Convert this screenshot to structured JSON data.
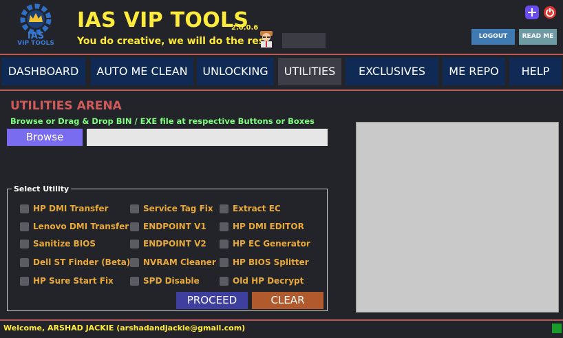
{
  "header": {
    "logo_line1": "IAS",
    "logo_line2": "VIP TOOLS",
    "title": "IAS VIP TOOLS",
    "version": "2.0.0.6",
    "tagline": "You do creative, we will do the rest",
    "logout_label": "LOGOUT",
    "readme_label": "READ ME"
  },
  "nav": {
    "tabs": [
      {
        "label": "DASHBOARD"
      },
      {
        "label": "AUTO ME CLEAN"
      },
      {
        "label": "UNLOCKING"
      },
      {
        "label": "UTILITIES"
      },
      {
        "label": "EXCLUSIVES"
      },
      {
        "label": "ME REPO"
      },
      {
        "label": "HELP"
      }
    ],
    "active": "UTILITIES"
  },
  "main": {
    "section_title": "UTILITIES ARENA",
    "instructions": "Browse or Drag & Drop BIN / EXE file at respective Buttons or Boxes",
    "browse_label": "Browse",
    "file_path_value": "",
    "group_label": "Select Utility",
    "utilities": {
      "col1": [
        "HP DMI Transfer",
        "Lenovo DMI Transfer",
        "Sanitize BIOS",
        "Dell ST Finder (Beta)",
        "HP Sure Start Fix"
      ],
      "col2": [
        "Service Tag Fix",
        "ENDPOINT V1",
        "ENDPOINT V2",
        "NVRAM Cleaner",
        "SPD Disable"
      ],
      "col3": [
        "Extract EC",
        "HP DMI EDITOR",
        "HP EC Generator",
        "HP BIOS Splitter",
        "Old HP Decrypt"
      ]
    },
    "proceed_label": "PROCEED",
    "clear_label": "CLEAR"
  },
  "status": {
    "welcome": "Welcome, ARSHAD JACKIE (arshadandjackie@gmail.com)"
  },
  "colors": {
    "accent_yellow": "#ffeb3b",
    "nav_bg": "#0f2a55",
    "section_red": "#d25a5a",
    "instruction_green": "#7fff7f",
    "option_orange": "#e8a93a"
  }
}
